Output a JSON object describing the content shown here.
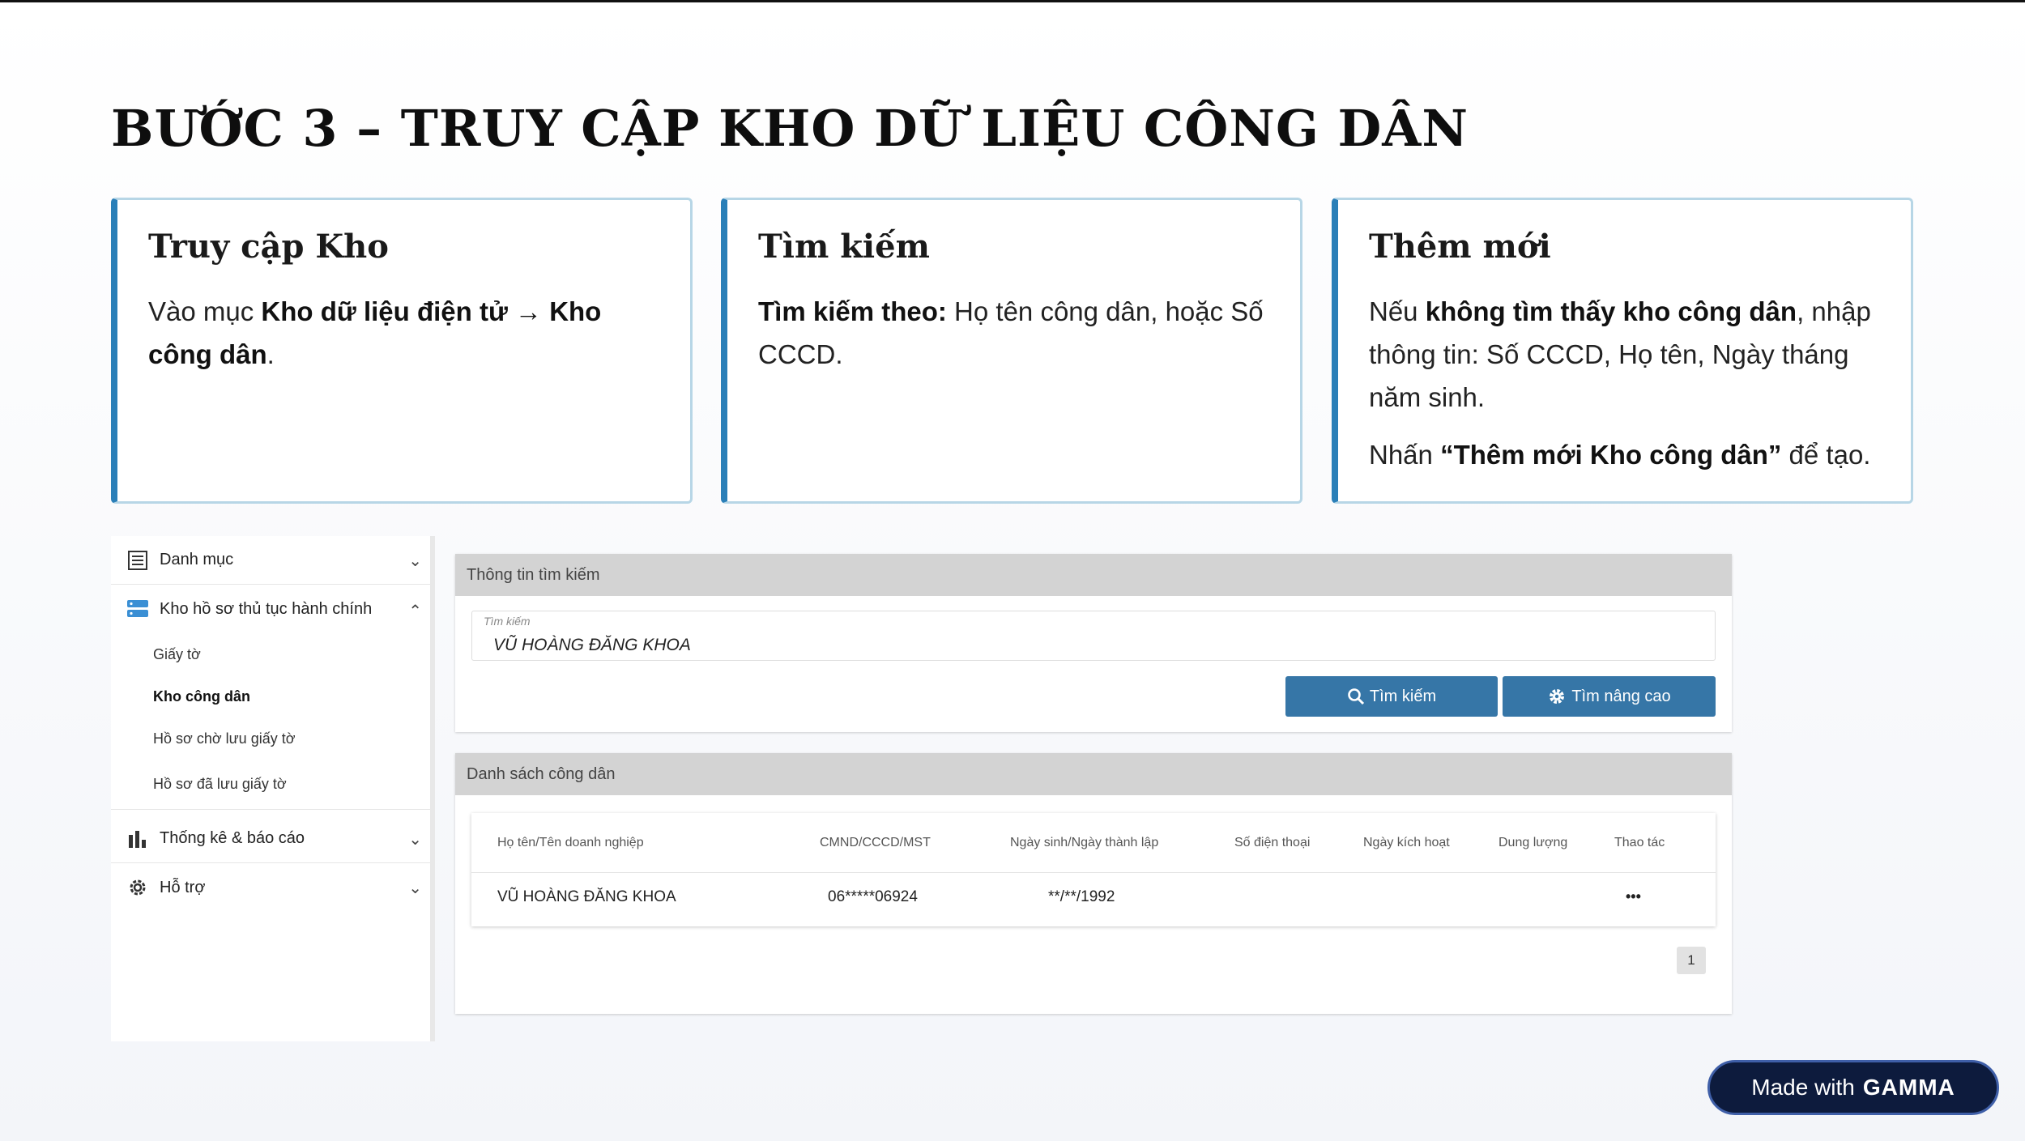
{
  "page": {
    "title": "BƯỚC 3 – TRUY CẬP KHO DỮ LIỆU CÔNG DÂN"
  },
  "cards": [
    {
      "title": "Truy cập Kho",
      "p1_pre": "Vào mục ",
      "p1_bold": "Kho dữ liệu điện tử → Kho công dân",
      "p1_post": "."
    },
    {
      "title": "Tìm kiếm",
      "p1_bold": "Tìm kiếm theo:",
      "p1_post": " Họ tên công dân, hoặc Số CCCD."
    },
    {
      "title": "Thêm mới",
      "p1_pre": "Nếu ",
      "p1_bold": "không tìm thấy kho công dân",
      "p1_post": ", nhập thông tin: Số CCCD, Họ tên, Ngày tháng năm sinh.",
      "p2_pre": "Nhấn ",
      "p2_bold": "“Thêm mới Kho công dân”",
      "p2_post": " để tạo."
    }
  ],
  "sidebar": {
    "danh_muc": "Danh mục",
    "kho_ho_so": "Kho hồ sơ thủ tục hành chính",
    "sub_items": [
      "Giấy tờ",
      "Kho công dân",
      "Hồ sơ chờ lưu giấy tờ",
      "Hồ sơ đã lưu giấy tờ"
    ],
    "thong_ke": "Thống kê & báo cáo",
    "ho_tro": "Hỗ trợ"
  },
  "search": {
    "header": "Thông tin tìm kiếm",
    "field_label": "Tìm kiếm",
    "field_value": "VŨ HOÀNG ĐĂNG KHOA",
    "btn_search": "Tìm kiếm",
    "btn_advanced": "Tìm nâng cao"
  },
  "list": {
    "header": "Danh sách công dân",
    "columns": [
      "Họ tên/Tên doanh nghiệp",
      "CMND/CCCD/MST",
      "Ngày sinh/Ngày thành lập",
      "Số điện thoại",
      "Ngày kích hoạt",
      "Dung lượng",
      "Thao tác"
    ],
    "rows": [
      {
        "name": "VŨ HOÀNG ĐĂNG KHOA",
        "id": "06*****06924",
        "dob": "**/**/1992",
        "phone": "",
        "activated": "",
        "size": "",
        "action": "•••"
      }
    ],
    "page": "1"
  },
  "badge": {
    "text": "Made with",
    "brand": "GAMMA"
  },
  "colors": {
    "accent": "#2a7fb8",
    "button": "#3676a7",
    "badge_bg": "#0d1b3d"
  }
}
